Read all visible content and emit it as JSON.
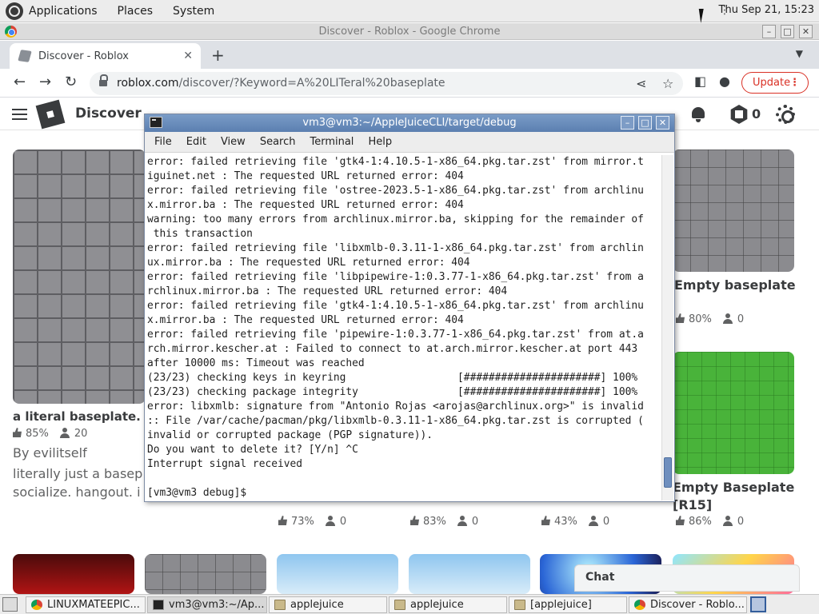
{
  "panel": {
    "menus": [
      "Applications",
      "Places",
      "System"
    ],
    "clock": "Thu Sep 21, 15:23"
  },
  "chrome": {
    "window_title": "Discover - Roblox - Google Chrome",
    "tab_title": "Discover - Roblox",
    "url_host": "roblox.com",
    "url_path": "/discover/?Keyword=A%20LITeral%20baseplate",
    "update_label": "Update"
  },
  "roblox": {
    "nav_label": "Discover",
    "robux_count": "0",
    "games": [
      {
        "title": "a literal baseplate.",
        "likes": "85%",
        "players": "20",
        "by": "By evilitself",
        "desc_1": "literally just a basep",
        "desc_2": "socialize. hangout. i"
      },
      {
        "title": "Empty baseplate",
        "likes": "80%",
        "players": "0"
      },
      {
        "title": "Empty Baseplate",
        "title_2": "[R15]",
        "likes": "86%",
        "players": "0"
      }
    ],
    "row_stats": [
      {
        "likes": "73%",
        "players": "0"
      },
      {
        "likes": "83%",
        "players": "0"
      },
      {
        "likes": "43%",
        "players": "0"
      }
    ],
    "chat_label": "Chat"
  },
  "terminal": {
    "title": "vm3@vm3:~/AppleJuiceCLI/target/debug",
    "menu": [
      "File",
      "Edit",
      "View",
      "Search",
      "Terminal",
      "Help"
    ],
    "lines": [
      "error: failed retrieving file 'gtk4-1:4.10.5-1-x86_64.pkg.tar.zst' from mirror.t",
      "iguinet.net : The requested URL returned error: 404",
      "error: failed retrieving file 'ostree-2023.5-1-x86_64.pkg.tar.zst' from archlinu",
      "x.mirror.ba : The requested URL returned error: 404",
      "warning: too many errors from archlinux.mirror.ba, skipping for the remainder of",
      " this transaction",
      "error: failed retrieving file 'libxmlb-0.3.11-1-x86_64.pkg.tar.zst' from archlin",
      "ux.mirror.ba : The requested URL returned error: 404",
      "error: failed retrieving file 'libpipewire-1:0.3.77-1-x86_64.pkg.tar.zst' from a",
      "rchlinux.mirror.ba : The requested URL returned error: 404",
      "error: failed retrieving file 'gtk4-1:4.10.5-1-x86_64.pkg.tar.zst' from archlinu",
      "x.mirror.ba : The requested URL returned error: 404",
      "error: failed retrieving file 'pipewire-1:0.3.77-1-x86_64.pkg.tar.zst' from at.a",
      "rch.mirror.kescher.at : Failed to connect to at.arch.mirror.kescher.at port 443",
      "after 10000 ms: Timeout was reached",
      "(23/23) checking keys in keyring                  [######################] 100%",
      "(23/23) checking package integrity                [######################] 100%",
      "error: libxmlb: signature from \"Antonio Rojas <arojas@archlinux.org>\" is invalid",
      ":: File /var/cache/pacman/pkg/libxmlb-0.3.11-1-x86_64.pkg.tar.zst is corrupted (",
      "invalid or corrupted package (PGP signature)).",
      "Do you want to delete it? [Y/n] ^C",
      "Interrupt signal received",
      "",
      "[vm3@vm3 debug]$ "
    ]
  },
  "taskbar": {
    "tasks": [
      "LINUXMATEEPIC...",
      "vm3@vm3:~/Ap...",
      "applejuice",
      "applejuice",
      "[applejuice]",
      "Discover - Roblo..."
    ]
  }
}
